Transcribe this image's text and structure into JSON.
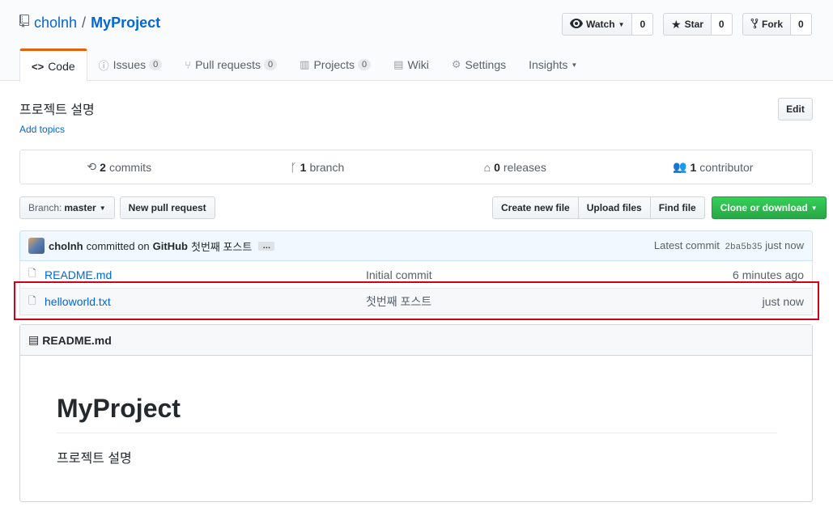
{
  "repo": {
    "owner": "cholnh",
    "separator": "/",
    "name": "MyProject"
  },
  "actions": {
    "watch": {
      "label": "Watch",
      "count": "0"
    },
    "star": {
      "label": "Star",
      "count": "0"
    },
    "fork": {
      "label": "Fork",
      "count": "0"
    }
  },
  "tabs": [
    {
      "label": "Code",
      "icon": "code-icon"
    },
    {
      "label": "Issues",
      "count": "0",
      "icon": "issue-icon"
    },
    {
      "label": "Pull requests",
      "count": "0",
      "icon": "pull-request-icon"
    },
    {
      "label": "Projects",
      "count": "0",
      "icon": "project-icon"
    },
    {
      "label": "Wiki",
      "icon": "book-icon"
    },
    {
      "label": "Settings",
      "icon": "gear-icon"
    },
    {
      "label": "Insights",
      "icon": "caret-down-icon"
    }
  ],
  "description": "프로젝트 설명",
  "add_topics": "Add topics",
  "edit_label": "Edit",
  "summary": {
    "commits": {
      "num": "2",
      "label": "commits"
    },
    "branch": {
      "num": "1",
      "label": "branch"
    },
    "releases": {
      "num": "0",
      "label": "releases"
    },
    "contributor": {
      "num": "1",
      "label": "contributor"
    }
  },
  "branch": {
    "prefix": "Branch:",
    "value": "master"
  },
  "new_pr": "New pull request",
  "file_actions": [
    "Create new file",
    "Upload files",
    "Find file"
  ],
  "clone": "Clone or download",
  "commit": {
    "author": "cholnh",
    "text_mid": "committed on",
    "via": "GitHub",
    "message": "첫번째 포스트",
    "ellipsis": "…",
    "latest_label": "Latest commit",
    "sha": "2ba5b35",
    "time": "just now"
  },
  "files": [
    {
      "name": "README.md",
      "message": "Initial commit",
      "age": "6 minutes ago"
    },
    {
      "name": "helloworld.txt",
      "message": "첫번째 포스트",
      "age": "just now"
    }
  ],
  "readme": {
    "header": "README.md",
    "title": "MyProject",
    "body": "프로젝트 설명"
  },
  "colors": {
    "link": "#0366d6",
    "accent": "#e36209",
    "highlight": "#d0021b",
    "green": "#28a745"
  }
}
